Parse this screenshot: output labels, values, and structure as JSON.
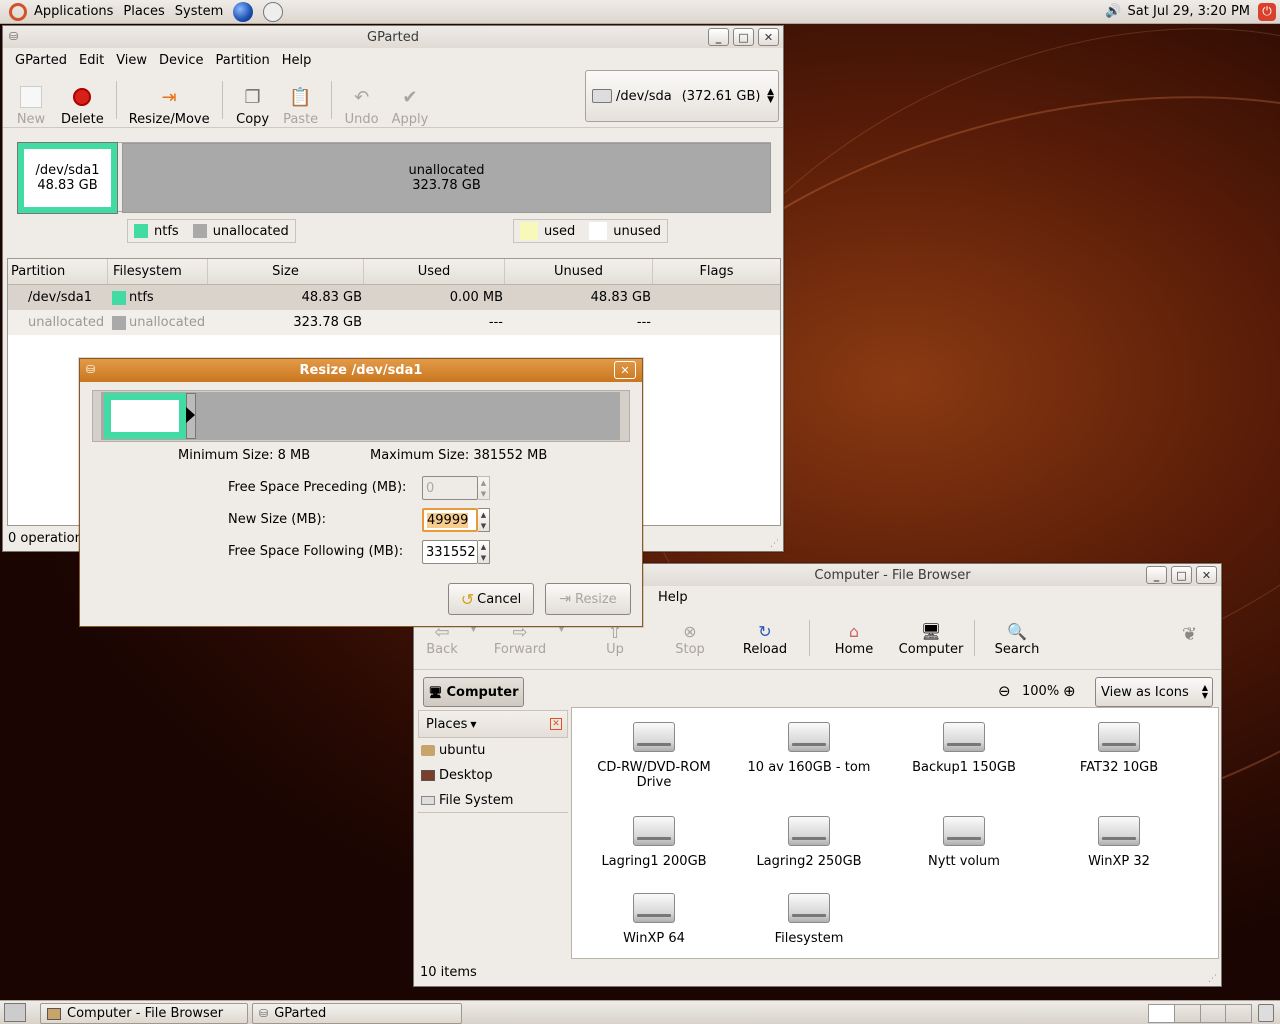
{
  "panel": {
    "applications": "Applications",
    "places": "Places",
    "system": "System",
    "clock": "Sat Jul 29,  3:20 PM"
  },
  "gparted": {
    "title": "GParted",
    "menu": [
      "GParted",
      "Edit",
      "View",
      "Device",
      "Partition",
      "Help"
    ],
    "toolbar": {
      "new": "New",
      "delete": "Delete",
      "resize": "Resize/Move",
      "copy": "Copy",
      "paste": "Paste",
      "undo": "Undo",
      "apply": "Apply"
    },
    "device": {
      "name": "/dev/sda",
      "size": "(372.61 GB)"
    },
    "graph": {
      "p1_name": "/dev/sda1",
      "p1_size": "48.83 GB",
      "un_name": "unallocated",
      "un_size": "323.78 GB"
    },
    "legend": {
      "ntfs": "ntfs",
      "unallocated": "unallocated",
      "used": "used",
      "unused": "unused"
    },
    "columns": [
      "Partition",
      "Filesystem",
      "Size",
      "Used",
      "Unused",
      "Flags"
    ],
    "rows": [
      {
        "partition": "/dev/sda1",
        "fs": "ntfs",
        "size": "48.83 GB",
        "used": "0.00 MB",
        "unused": "48.83 GB",
        "flags": ""
      },
      {
        "partition": "unallocated",
        "fs": "unallocated",
        "size": "323.78 GB",
        "used": "---",
        "unused": "---",
        "flags": ""
      }
    ],
    "status": "0 operation"
  },
  "resize": {
    "title": "Resize /dev/sda1",
    "min": "Minimum Size: 8 MB",
    "max": "Maximum Size: 381552 MB",
    "preceding_label": "Free Space Preceding (MB):",
    "preceding_value": "0",
    "newsize_label": "New Size (MB):",
    "newsize_value": "49999",
    "following_label": "Free Space Following (MB):",
    "following_value": "331552",
    "cancel": "Cancel",
    "resize": "Resize"
  },
  "browser": {
    "title": "Computer - File Browser",
    "menu_help": "Help",
    "toolbar": {
      "back": "Back",
      "forward": "Forward",
      "up": "Up",
      "stop": "Stop",
      "reload": "Reload",
      "home": "Home",
      "computer": "Computer",
      "search": "Search"
    },
    "location": "Computer",
    "zoom": "100%",
    "view": "View as Icons",
    "places_label": "Places",
    "places": [
      "ubuntu",
      "Desktop",
      "File System"
    ],
    "items": [
      "CD-RW/DVD-ROM Drive",
      "10 av 160GB - tom",
      "Backup1 150GB",
      "FAT32 10GB",
      "Lagring1 200GB",
      "Lagring2 250GB",
      "Nytt volum",
      "WinXP 32",
      "WinXP 64",
      "Filesystem"
    ],
    "status": "10 items"
  },
  "taskbar": {
    "t1": "Computer - File Browser",
    "t2": "GParted"
  },
  "colors": {
    "ntfs": "#42dba4",
    "unallocated": "#a9a9a9",
    "used": "#f8f8ba",
    "unused": "#ffffff",
    "dialog_title": "#c9771e"
  }
}
